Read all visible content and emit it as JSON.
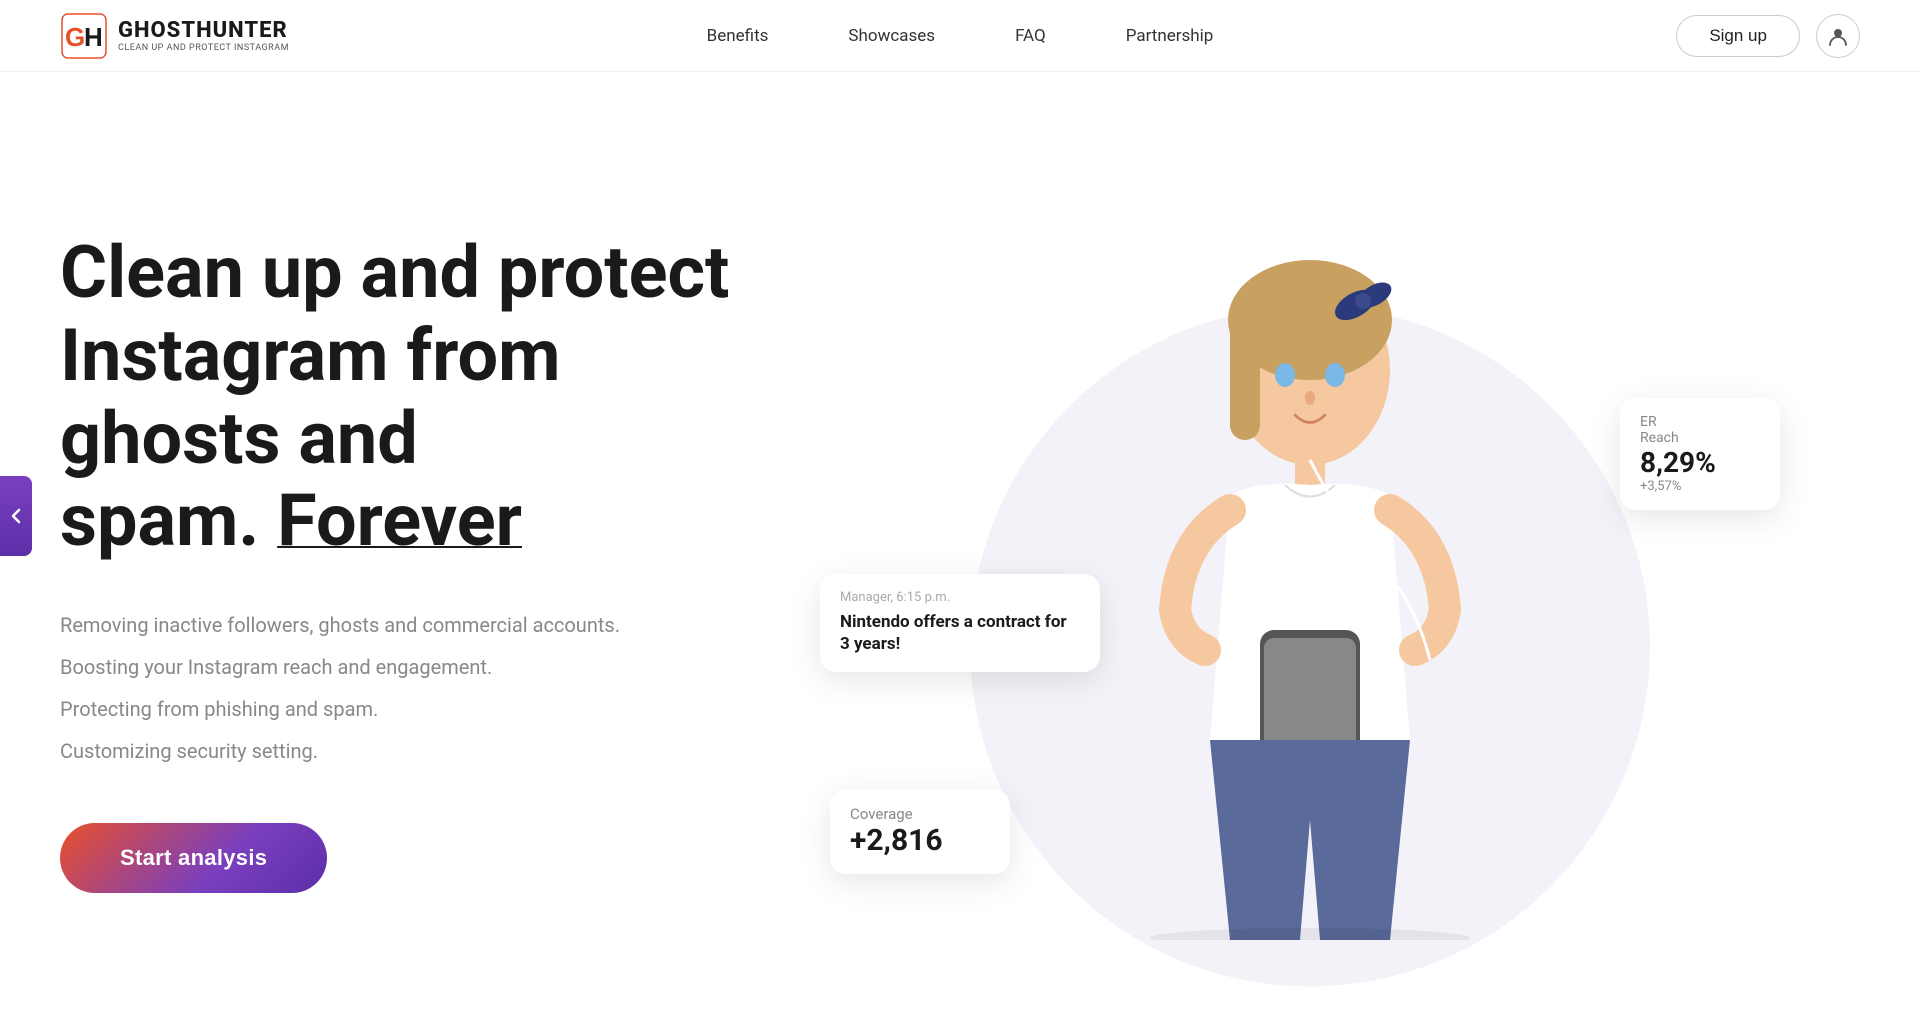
{
  "brand": {
    "name": "GHOSTHUNTER",
    "tagline": "CLEAN UP AND PROTECT INSTAGRAM",
    "logo_gh": "GH"
  },
  "nav": {
    "items": [
      {
        "label": "Benefits",
        "href": "#"
      },
      {
        "label": "Showcases",
        "href": "#"
      },
      {
        "label": "FAQ",
        "href": "#"
      },
      {
        "label": "Partnership",
        "href": "#"
      }
    ]
  },
  "header": {
    "signup_label": "Sign up"
  },
  "hero": {
    "title_line1": "Clean up and protect",
    "title_line2": "Instagram from ghosts and",
    "title_line3": "spam. ",
    "title_forever": "Forever",
    "features": [
      "Removing inactive followers, ghosts and commercial accounts.",
      "Boosting your Instagram reach and engagement.",
      "Protecting from phishing and spam.",
      "Customizing security setting."
    ],
    "cta_label": "Start analysis"
  },
  "floating_cards": {
    "er_reach": {
      "label_line1": "ER",
      "label_line2": "Reach",
      "value": "8,29%",
      "delta": "+3,57%"
    },
    "message": {
      "sender": "Manager, 6:15 p.m.",
      "text": "Nintendo offers a contract for 3 years!"
    },
    "coverage": {
      "label": "Coverage",
      "value": "+2,816"
    }
  },
  "colors": {
    "accent_gradient_start": "#e8502a",
    "accent_gradient_end": "#7b3fbe",
    "text_primary": "#1a1a1a",
    "text_muted": "#888888"
  }
}
